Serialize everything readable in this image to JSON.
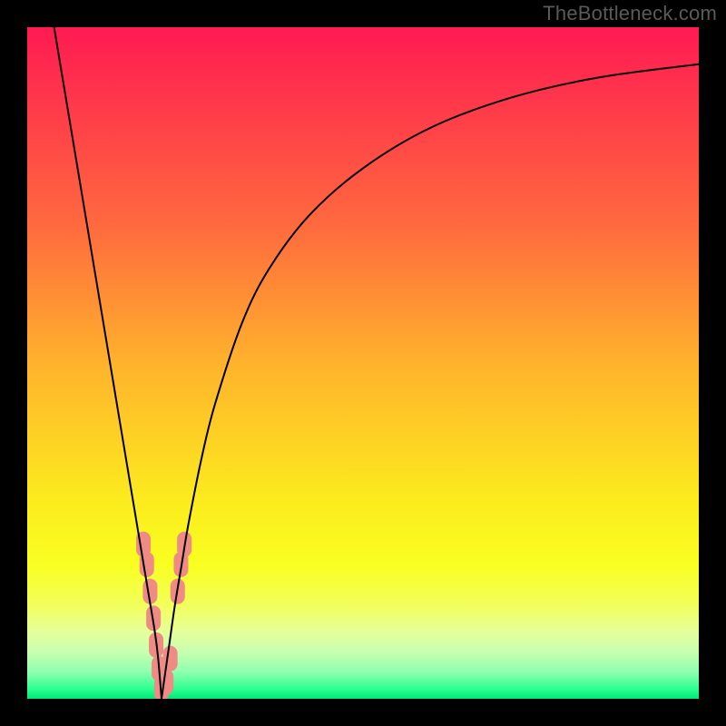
{
  "watermark": "TheBottleneck.com",
  "chart_data": {
    "type": "line",
    "title": "",
    "xlabel": "",
    "ylabel": "",
    "xlim": [
      0,
      100
    ],
    "ylim": [
      0,
      100
    ],
    "series": [
      {
        "name": "left-branch",
        "x": [
          4,
          6,
          8,
          10,
          12,
          14,
          15,
          16,
          17,
          18,
          19,
          19.5,
          20
        ],
        "y": [
          100,
          88,
          76,
          64,
          52,
          40,
          34,
          28,
          22,
          16,
          10,
          6,
          0
        ]
      },
      {
        "name": "right-branch",
        "x": [
          20,
          21,
          22,
          23,
          24,
          26,
          28,
          32,
          36,
          42,
          50,
          60,
          72,
          85,
          100
        ],
        "y": [
          0,
          7,
          14,
          20,
          26,
          36,
          44,
          56,
          64,
          72,
          79,
          85,
          89.5,
          92.5,
          94.5
        ]
      }
    ],
    "markers": {
      "name": "pink-dots",
      "color": "#ef8a84",
      "points": [
        {
          "x": 17.3,
          "y": 23
        },
        {
          "x": 17.8,
          "y": 20
        },
        {
          "x": 18.3,
          "y": 16
        },
        {
          "x": 18.8,
          "y": 12
        },
        {
          "x": 19.2,
          "y": 8
        },
        {
          "x": 19.6,
          "y": 4.5
        },
        {
          "x": 20.0,
          "y": 1.5
        },
        {
          "x": 20.7,
          "y": 2.5
        },
        {
          "x": 21.3,
          "y": 6
        },
        {
          "x": 22.4,
          "y": 16
        },
        {
          "x": 22.9,
          "y": 20
        },
        {
          "x": 23.4,
          "y": 23
        }
      ]
    },
    "gradient_stops": [
      {
        "pos": 0.0,
        "color": "#ff1a52"
      },
      {
        "pos": 0.12,
        "color": "#ff3a4a"
      },
      {
        "pos": 0.3,
        "color": "#ff6b3e"
      },
      {
        "pos": 0.5,
        "color": "#ffb22c"
      },
      {
        "pos": 0.7,
        "color": "#fcea1e"
      },
      {
        "pos": 0.8,
        "color": "#f9ff20"
      },
      {
        "pos": 0.86,
        "color": "#f2ff5a"
      },
      {
        "pos": 0.9,
        "color": "#e6ff9a"
      },
      {
        "pos": 0.93,
        "color": "#c8ffb0"
      },
      {
        "pos": 0.96,
        "color": "#8fffb0"
      },
      {
        "pos": 0.985,
        "color": "#2fff90"
      },
      {
        "pos": 1.0,
        "color": "#00e877"
      }
    ]
  }
}
